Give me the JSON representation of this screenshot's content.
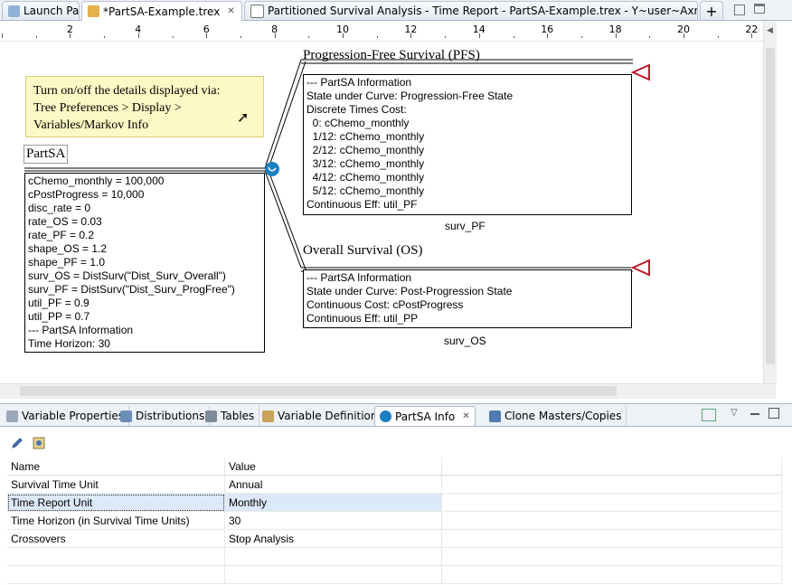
{
  "editor_tabs": [
    {
      "label": "Launch Pad"
    },
    {
      "label": "*PartSA-Example.trex"
    },
    {
      "label": "Partitioned Survival Analysis - Time Report - PartSA-Example.trex - Y~user~Axmor~Wo"
    }
  ],
  "ruler": [
    "2",
    "4",
    "6",
    "8",
    "10",
    "12",
    "14",
    "16",
    "18",
    "20",
    "22"
  ],
  "note": {
    "lines": [
      "Turn on/off the details displayed via:",
      "Tree Preferences > Display >",
      "Variables/Markov Info"
    ]
  },
  "root": {
    "name": "PartSA",
    "lines": [
      "cChemo_monthly = 100,000",
      "cPostProgress = 10,000",
      "disc_rate = 0",
      "rate_OS = 0.03",
      "rate_PF = 0.2",
      "shape_OS = 1.2",
      "shape_PF = 1.0",
      "surv_OS = DistSurv(\"Dist_Surv_Overall\")",
      "surv_PF = DistSurv(\"Dist_Surv_ProgFree\")",
      "util_PF = 0.9",
      "util_PP = 0.7",
      "--- PartSA Information",
      "Time Horizon: 30"
    ]
  },
  "pfs": {
    "title": "Progression-Free Survival (PFS)",
    "lines": [
      "--- PartSA Information",
      "State under Curve: Progression-Free State",
      "Discrete Times Cost:",
      "  0: cChemo_monthly",
      "  1/12: cChemo_monthly",
      "  2/12: cChemo_monthly",
      "  3/12: cChemo_monthly",
      "  4/12: cChemo_monthly",
      "  5/12: cChemo_monthly",
      "Continuous Eff: util_PF"
    ],
    "caption": "surv_PF"
  },
  "os": {
    "title": "Overall Survival (OS)",
    "lines": [
      "--- PartSA Information",
      "State under Curve: Post-Progression State",
      "Continuous Cost: cPostProgress",
      "Continuous Eff: util_PP"
    ],
    "caption": "surv_OS"
  },
  "view_tabs": [
    {
      "label": "Variable Properties"
    },
    {
      "label": "Distributions"
    },
    {
      "label": "Tables"
    },
    {
      "label": "Variable Definitions"
    },
    {
      "label": "PartSA Info"
    },
    {
      "label": "Clone Masters/Copies"
    }
  ],
  "table": {
    "headers": [
      "Name",
      "Value"
    ],
    "rows": [
      [
        "Survival Time Unit",
        "Annual"
      ],
      [
        "Time Report Unit",
        "Monthly"
      ],
      [
        "Time Horizon (in Survival Time Units)",
        "30"
      ],
      [
        "Crossovers",
        "Stop Analysis"
      ]
    ]
  },
  "colors": {
    "accent": "#1a7fc1",
    "terminal": "#c0182a",
    "note_bg": "#fdf9c5",
    "selection": "#dce9f8"
  }
}
